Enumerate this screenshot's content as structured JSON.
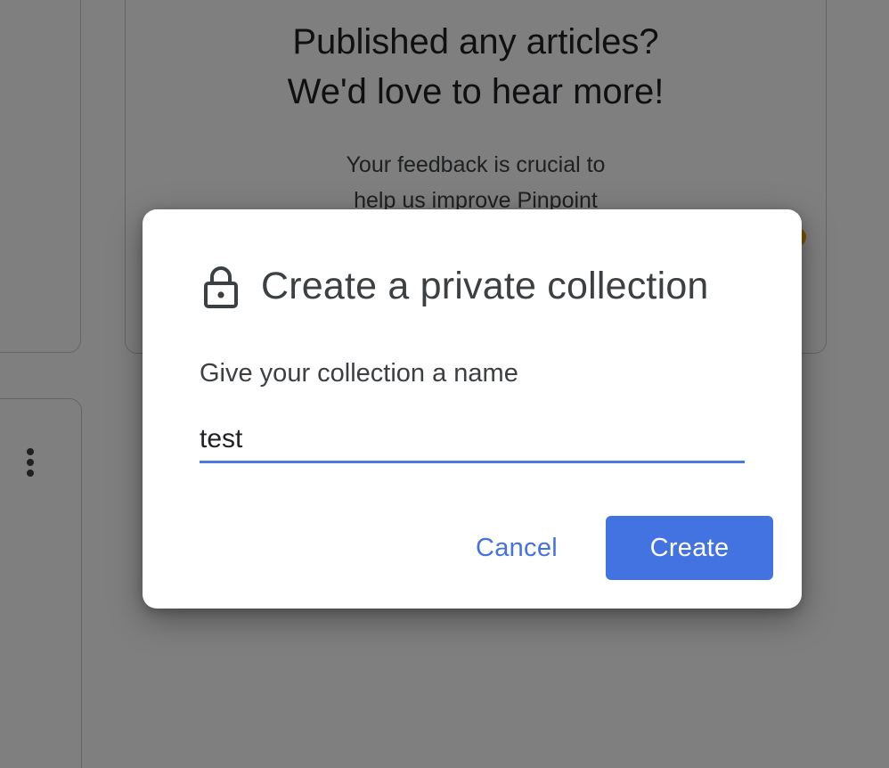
{
  "background": {
    "feedback_card": {
      "title_lines": [
        "Published any articles?",
        "We'd love to hear more!"
      ],
      "subtitle_lines": [
        "Your feedback is crucial to",
        "help us improve Pinpoint"
      ]
    },
    "menu_icon": "more-vert-icon"
  },
  "dialog": {
    "icon": "lock-icon",
    "title": "Create a private collection",
    "field_label": "Give your collection a name",
    "field_value": "test",
    "cancel_label": "Cancel",
    "create_label": "Create"
  },
  "colors": {
    "accent": "#4373e0",
    "scrim": "rgba(0,0,0,0.5)",
    "text_primary": "#3c4043",
    "badge": "#f9ab00"
  }
}
